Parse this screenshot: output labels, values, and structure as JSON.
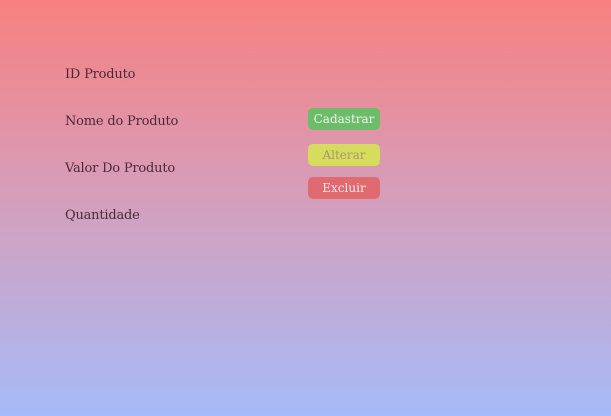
{
  "form": {
    "labels": {
      "id": "ID Produto",
      "nome": "Nome do Produto",
      "valor": "Valor Do Produto",
      "quantidade": "Quantidade"
    }
  },
  "actions": {
    "cadastrar": "Cadastrar",
    "alterar": "Alterar",
    "excluir": "Excluir"
  },
  "colors": {
    "background_top": "#f8807f",
    "background_bottom": "#a6bbf8",
    "cadastrar": "#6cbc69",
    "alterar": "#d6dc5e",
    "excluir": "#df6b71"
  }
}
